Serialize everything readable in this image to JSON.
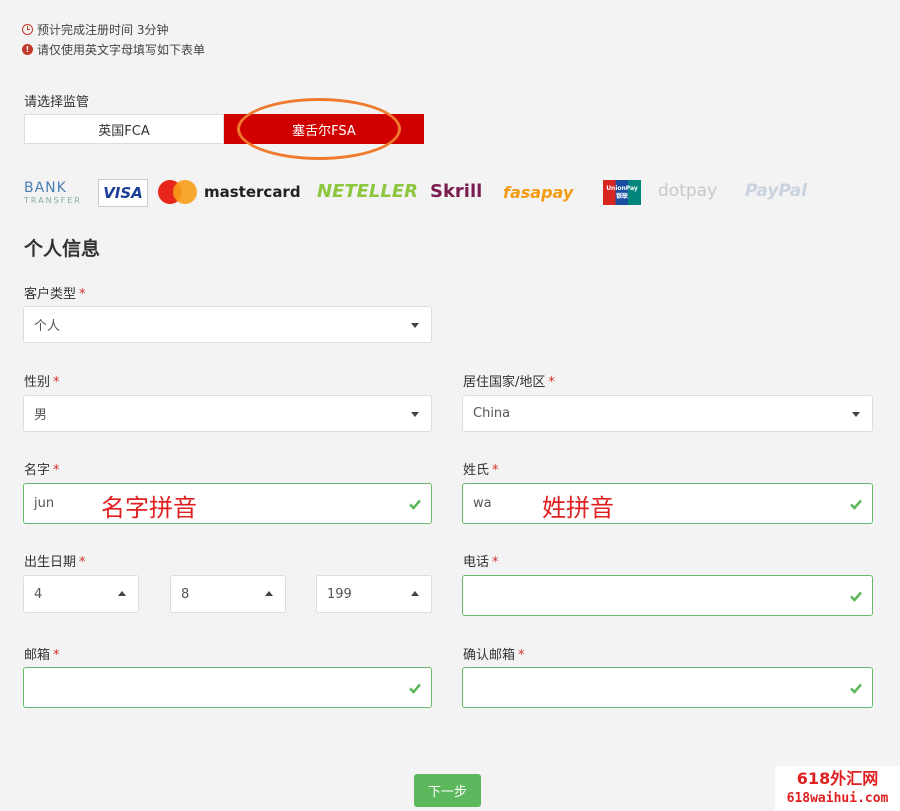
{
  "notices": {
    "time": "预计完成注册时间 3分钟",
    "english_only": "请仅使用英文字母填写如下表单"
  },
  "regulator": {
    "label": "请选择监管",
    "options": [
      "英国FCA",
      "塞舌尔FSA"
    ],
    "selected": "塞舌尔FSA"
  },
  "payment_logos": {
    "bank_transfer_top": "BANK",
    "bank_transfer_bottom": "TRANSFER",
    "visa": "VISA",
    "mastercard": "mastercard",
    "neteller": "NETELLER",
    "skrill": "Skrill",
    "fasapay": "fasapay",
    "unionpay": "UnionPay 银联",
    "dotpay": "dotpay",
    "paypal": "PayPal"
  },
  "section_title": "个人信息",
  "form": {
    "client_type": {
      "label": "客户类型",
      "value": "个人"
    },
    "gender": {
      "label": "性别",
      "value": "男"
    },
    "country": {
      "label": "居住国家/地区",
      "value": "China"
    },
    "first_name": {
      "label": "名字",
      "value": "jun",
      "annotation": "名字拼音"
    },
    "last_name": {
      "label": "姓氏",
      "value": "wa",
      "annotation": "姓拼音"
    },
    "dob": {
      "label": "出生日期",
      "day": "4",
      "month": "8",
      "year": "199"
    },
    "phone": {
      "label": "电话",
      "value": ""
    },
    "email": {
      "label": "邮箱",
      "value": ""
    },
    "confirm_email": {
      "label": "确认邮箱",
      "value": ""
    },
    "required_mark": "*"
  },
  "next_button": "下一步",
  "watermark": {
    "line1": "618外汇网",
    "line2": "618waihui.com"
  },
  "colors": {
    "accent_red": "#d00000",
    "valid_green": "#6ab96a",
    "button_green": "#5cb85c",
    "annotation_orange": "#f07b2e"
  }
}
